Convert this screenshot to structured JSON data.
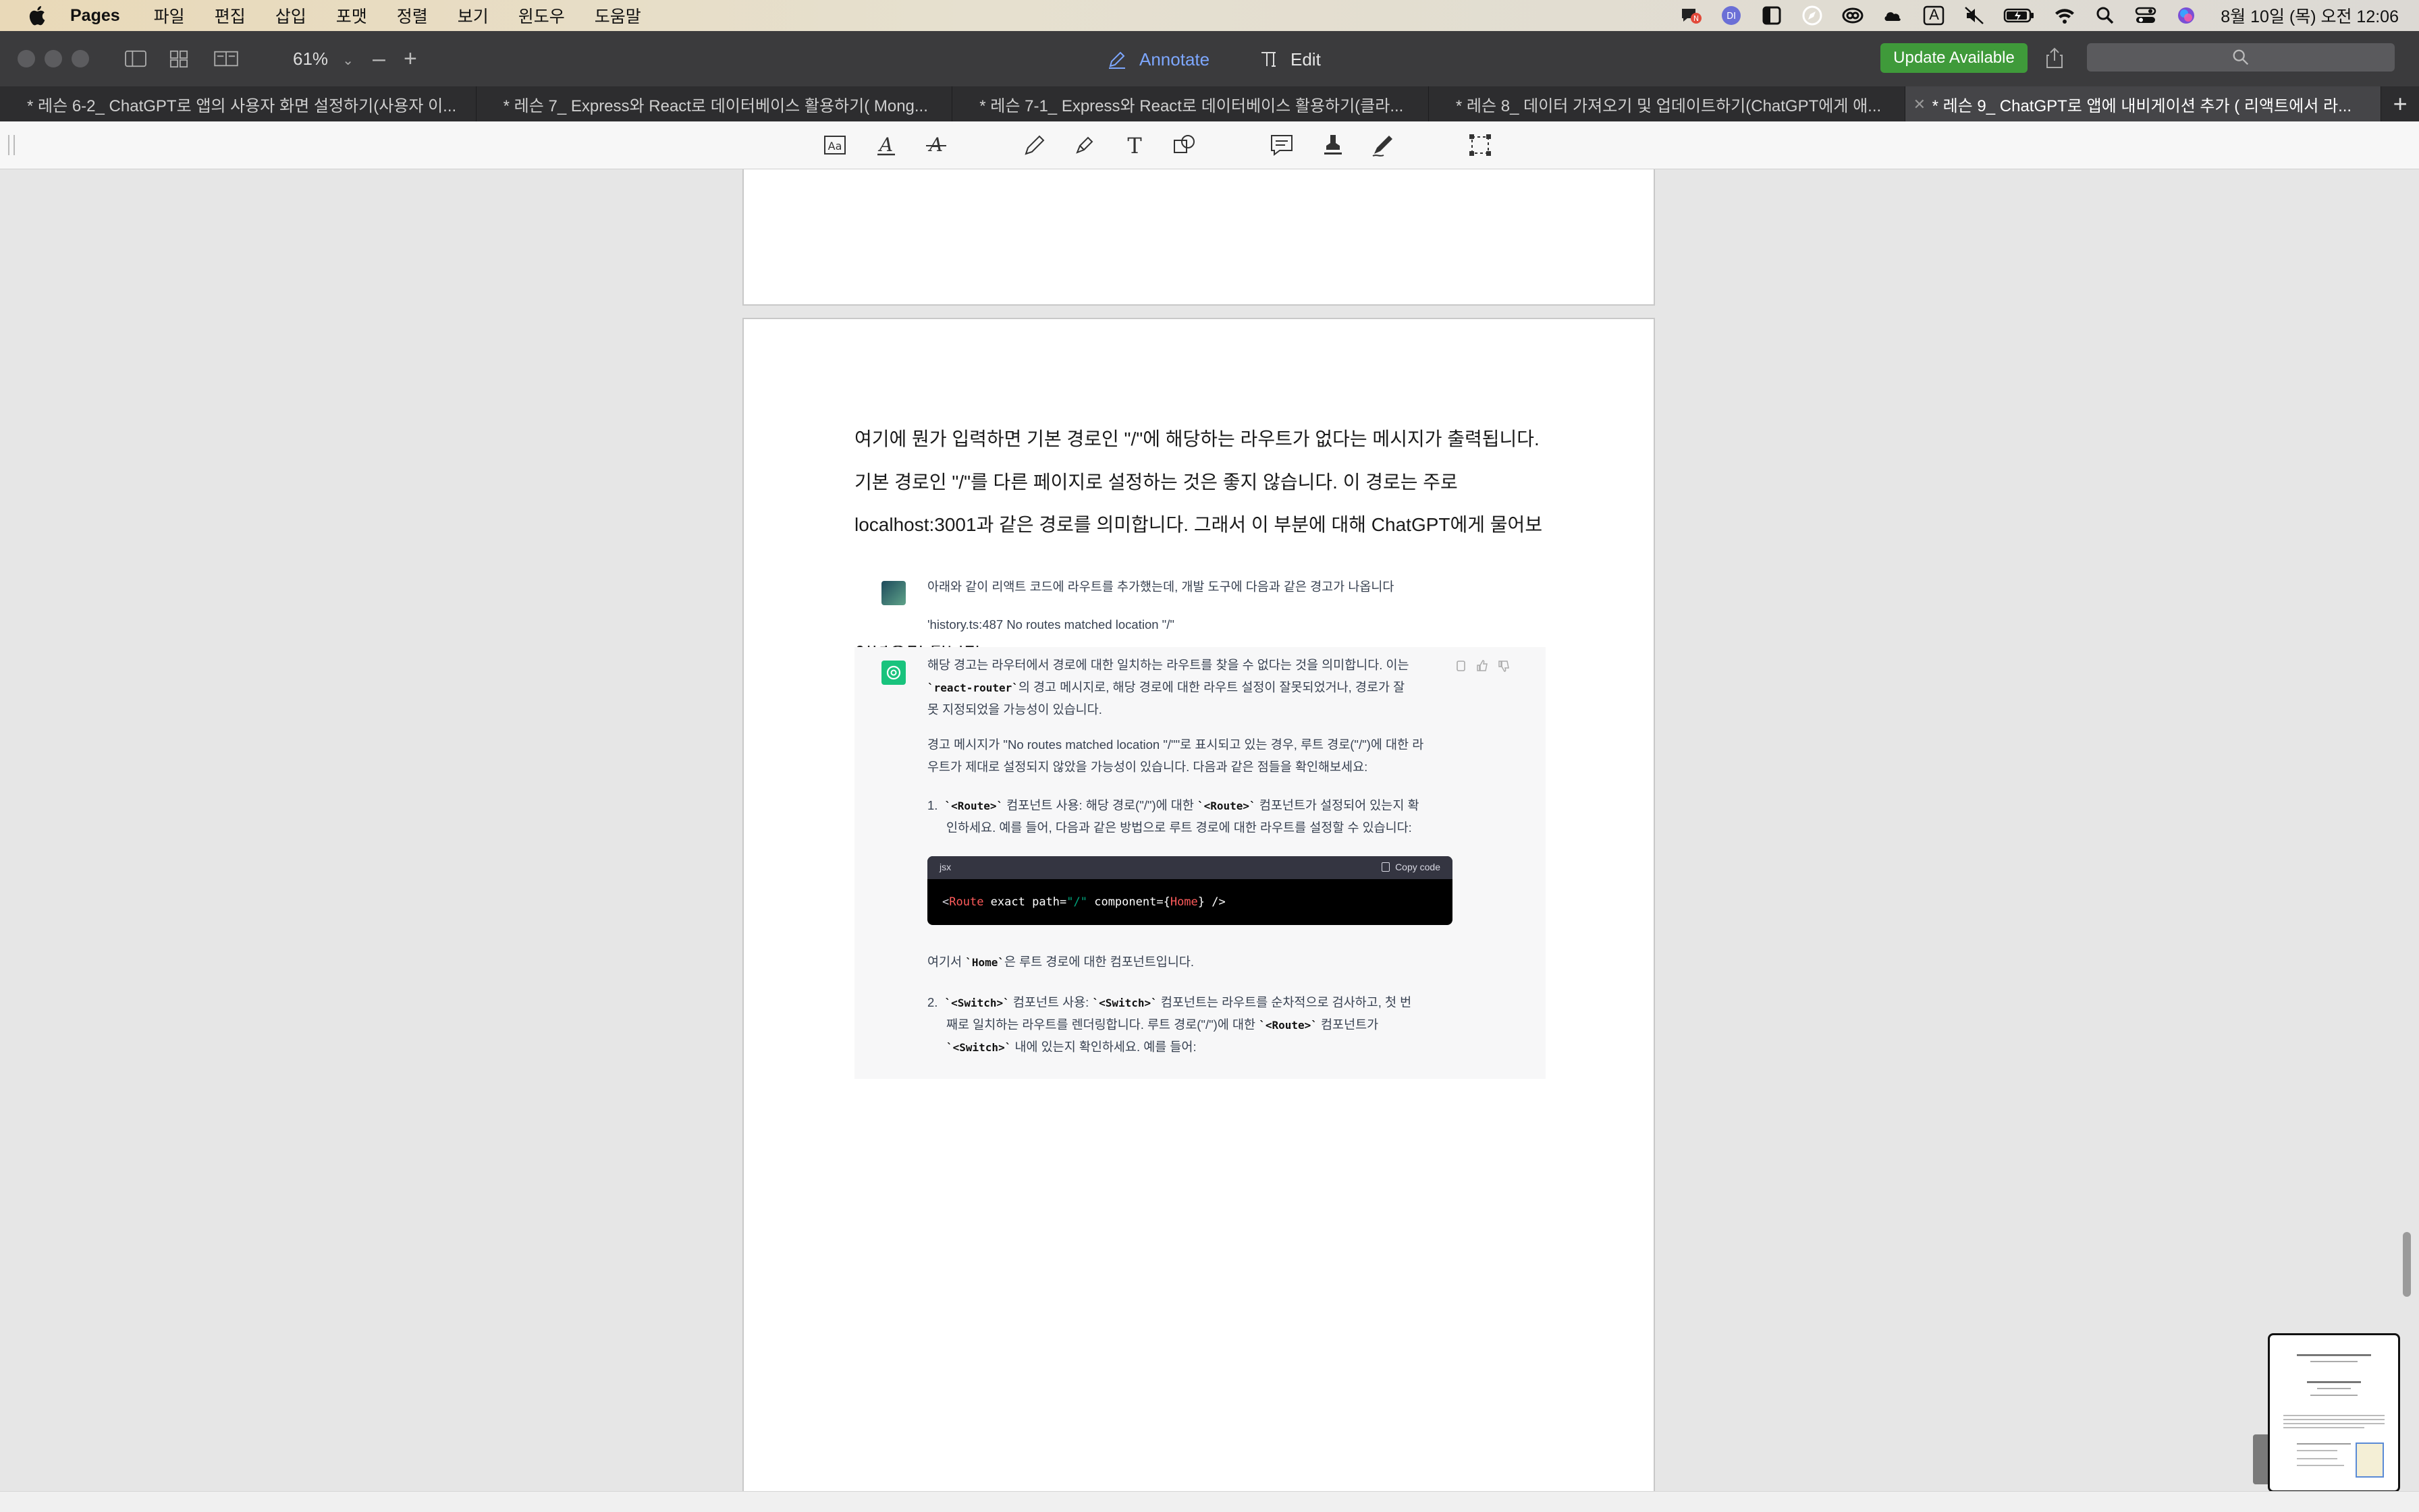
{
  "menubar": {
    "app_name": "Pages",
    "items": [
      "파일",
      "편집",
      "삽입",
      "포맷",
      "정렬",
      "보기",
      "윈도우",
      "도움말"
    ],
    "clock": "8월 10일 (목) 오전 12:06",
    "tray_icons": [
      "notification-badge-icon",
      "d-app-icon",
      "sidebar-icon",
      "compass-icon",
      "creative-cloud-icon",
      "cloud-icon",
      "input-source-icon",
      "mute-icon",
      "battery-icon",
      "wifi-icon",
      "spotlight-icon",
      "control-center-icon",
      "siri-icon"
    ],
    "input_source_label": "A"
  },
  "toolbar": {
    "zoom": "61%",
    "annotate_label": "Annotate",
    "edit_label": "Edit",
    "update_label": "Update Available",
    "accent": "#7da7ff"
  },
  "tabs": [
    {
      "label": "* 레슨 6-2_ ChatGPT로 앱의 사용자 화면 설정하기(사용자 이..."
    },
    {
      "label": "* 레슨 7_ Express와 React로 데이터베이스 활용하기( Mong..."
    },
    {
      "label": "* 레슨 7-1_ Express와 React로 데이터베이스 활용하기(클라..."
    },
    {
      "label": "* 레슨 8_ 데이터 가져오기 및 업데이트하기(ChatGPT에게 애..."
    },
    {
      "label": "* 레슨 9_ ChatGPT로 앱에 내비게이션 추가 ( 리액트에서 라...",
      "active": true
    }
  ],
  "document": {
    "paragraph": "여기에 뭔가 입력하면 기본 경로인 \"/\"에 해당하는 라우트가 없다는 메시지가 출력됩니다. 기본 경로인 \"/\"를 다른 페이지로 설정하는 것은 좋지 않습니다. 이 경로는 주로 localhost:3001과 같은 경로를 의미합니다. 그래서 이 부분에 대해 ChatGPT에게 물어보는 것이 좋습니다. ChatGPT로 가서 다음과 같이 리액트 코드에 라우트를 추가했는데 개발 도구에 다음과 같은 경고 메시지가 나옵니다. 경고 메시지를 복사해서 ChatGPT에 붙여넣으면 됩니다."
  },
  "chat": {
    "user_line1": "아래와 같이 리액트 코드에 라우트를 추가했는데, 개발 도구에 다음과 같은 경고가 나옵니다",
    "user_line2": "'history.ts:487 No routes matched location \"/\"",
    "bot_p1_a": "해당 경고는 라우터에서 경로에 대한 일치하는 라우트를 찾을 수 없다는 것을 의미합니다. 이는",
    "bot_p1_code": "`react-router`",
    "bot_p1_b": "의 경고 메시지로, 해당 경로에 대한 라우트 설정이 잘못되었거나, 경로가 잘",
    "bot_p1_c": "못 지정되었을 가능성이 있습니다.",
    "bot_p2_a": "경고 메시지가 \"No routes matched location \"/\"\"로 표시되고 있는 경우, 루트 경로(\"/\")에 대한 라",
    "bot_p2_b": "우트가 제대로 설정되지 않았을 가능성이 있습니다. 다음과 같은 점들을 확인해보세요:",
    "item1_num": "1.",
    "item1_code1": "`<Route>`",
    "item1_a": "컴포넌트 사용: 해당 경로(\"/\")에 대한",
    "item1_code2": "`<Route>`",
    "item1_b": "컴포넌트가 설정되어 있는지 확",
    "item1_c": "인하세요. 예를 들어, 다음과 같은 방법으로 루트 경로에 대한 라우트를 설정할 수 있습니다:",
    "code_lang": "jsx",
    "copy_label": "Copy code",
    "code": {
      "lt": "<",
      "tag": "Route",
      "attr1": " exact path=",
      "val1": "\"/\"",
      "attr2": " component=",
      "brace_open": "{",
      "comp": "Home",
      "brace_close": "}",
      "end": " />"
    },
    "p3_code": "`Home`",
    "p3_text": "은 루트 경로에 대한 컴포넌트입니다.",
    "p3_prefix": "여기서",
    "item2_num": "2.",
    "item2_code1": "`<Switch>`",
    "item2_a": "컴포넌트 사용:",
    "item2_code2": "`<Switch>`",
    "item2_b": "컴포넌트는 라우트를 순차적으로 검사하고, 첫 번",
    "item2_c": "째로 일치하는 라우트를 렌더링합니다. 루트 경로(\"/\")에 대한",
    "item2_code3": "`<Route>`",
    "item2_d": "컴포넌트가",
    "item2_code4": "`<Switch>`",
    "item2_e": "내에 있는지 확인하세요. 예를 들어:"
  }
}
